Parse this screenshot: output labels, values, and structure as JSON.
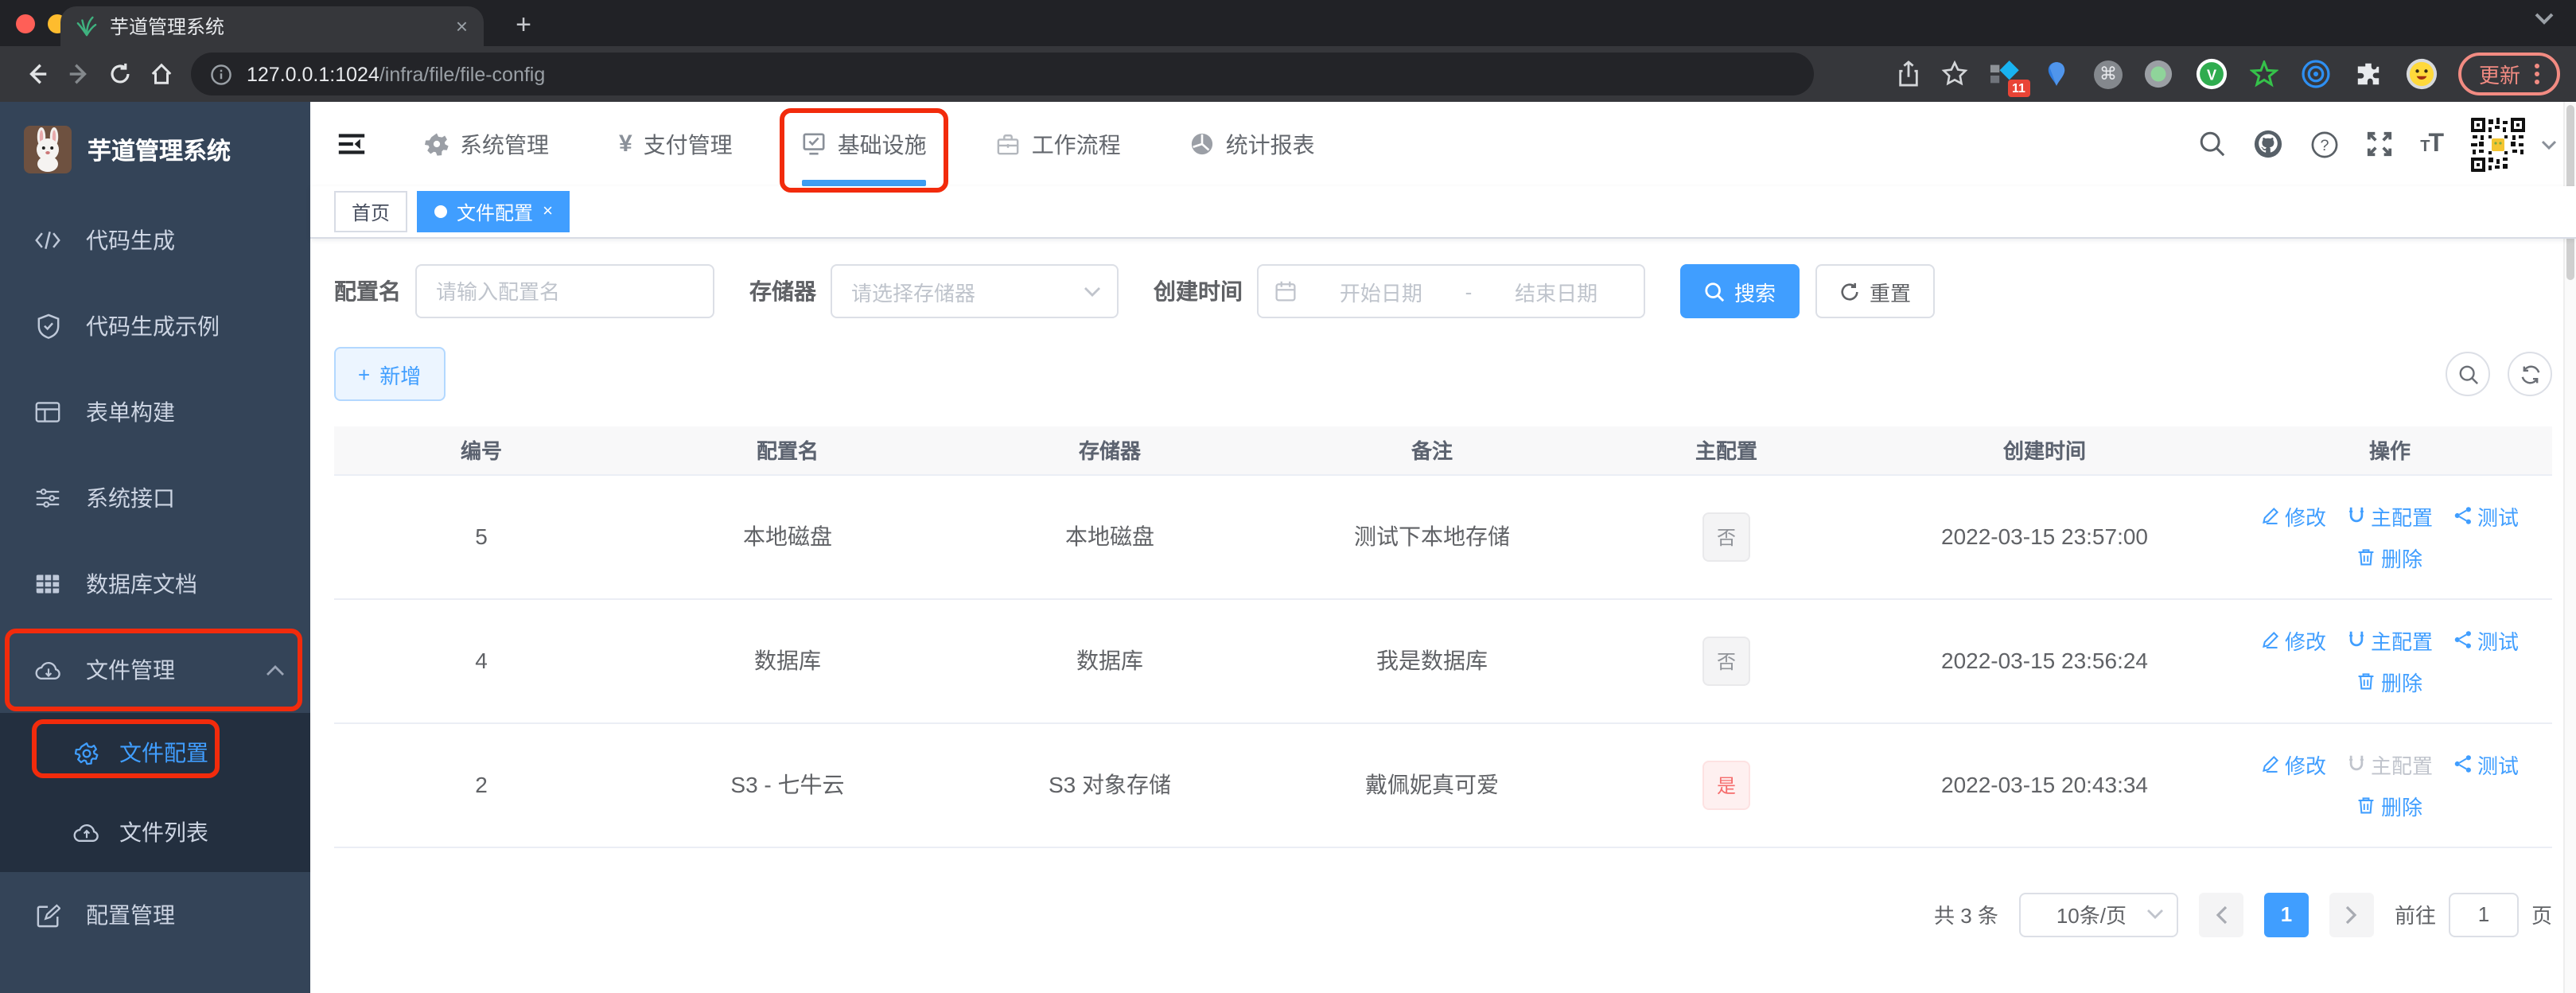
{
  "browser": {
    "tab_title": "芋道管理系统",
    "url_host": "127.0.0.1:1024",
    "url_path": "/infra/file/file-config",
    "ext_badge": "11",
    "update_label": "更新"
  },
  "icons": {
    "yen": "¥",
    "command": "⌘",
    "star_outline": "☆",
    "v_letter": "V",
    "question": "?",
    "plus": "+",
    "close": "×",
    "t_big": "T",
    "t_small": "T"
  },
  "sidebar": {
    "title": "芋道管理系统",
    "items": [
      {
        "label": "代码生成"
      },
      {
        "label": "代码生成示例"
      },
      {
        "label": "表单构建"
      },
      {
        "label": "系统接口"
      },
      {
        "label": "数据库文档"
      },
      {
        "label": "文件管理"
      },
      {
        "label": "文件配置"
      },
      {
        "label": "文件列表"
      },
      {
        "label": "配置管理"
      }
    ]
  },
  "topnav": {
    "items": [
      {
        "label": "系统管理"
      },
      {
        "label": "支付管理"
      },
      {
        "label": "基础设施"
      },
      {
        "label": "工作流程"
      },
      {
        "label": "统计报表"
      }
    ]
  },
  "tags": {
    "home": "首页",
    "active": "文件配置"
  },
  "filters": {
    "name_label": "配置名",
    "name_placeholder": "请输入配置名",
    "storage_label": "存储器",
    "storage_placeholder": "请选择存储器",
    "time_label": "创建时间",
    "start_placeholder": "开始日期",
    "range_separator": "-",
    "end_placeholder": "结束日期",
    "search_label": "搜索",
    "reset_label": "重置"
  },
  "toolbar": {
    "add_label": "新增"
  },
  "table": {
    "headers": [
      "编号",
      "配置名",
      "存储器",
      "备注",
      "主配置",
      "创建时间",
      "操作"
    ],
    "action_labels": {
      "edit": "修改",
      "main": "主配置",
      "test": "测试",
      "del": "删除"
    },
    "rows": [
      {
        "id": "5",
        "name": "本地磁盘",
        "storage": "本地磁盘",
        "remark": "测试下本地存储",
        "main": "否",
        "main_type": "info",
        "time": "2022-03-15 23:57:00",
        "main_config_disabled": false
      },
      {
        "id": "4",
        "name": "数据库",
        "storage": "数据库",
        "remark": "我是数据库",
        "main": "否",
        "main_type": "info",
        "time": "2022-03-15 23:56:24",
        "main_config_disabled": false
      },
      {
        "id": "2",
        "name": "S3 - 七牛云",
        "storage": "S3 对象存储",
        "remark": "戴佩妮真可爱",
        "main": "是",
        "main_type": "danger",
        "time": "2022-03-15 20:43:34",
        "main_config_disabled": true
      }
    ]
  },
  "pagination": {
    "total": "共 3 条",
    "page_size": "10条/页",
    "current_page": "1",
    "goto_label": "前往",
    "goto_value": "1",
    "page_suffix": "页"
  },
  "colors": {
    "accent": "#409eff",
    "sidebar_bg": "#344458",
    "submenu_bg": "#232f3f",
    "annotation": "#f22b0c",
    "tag_info": "#909399",
    "tag_danger": "#f56c6c"
  }
}
